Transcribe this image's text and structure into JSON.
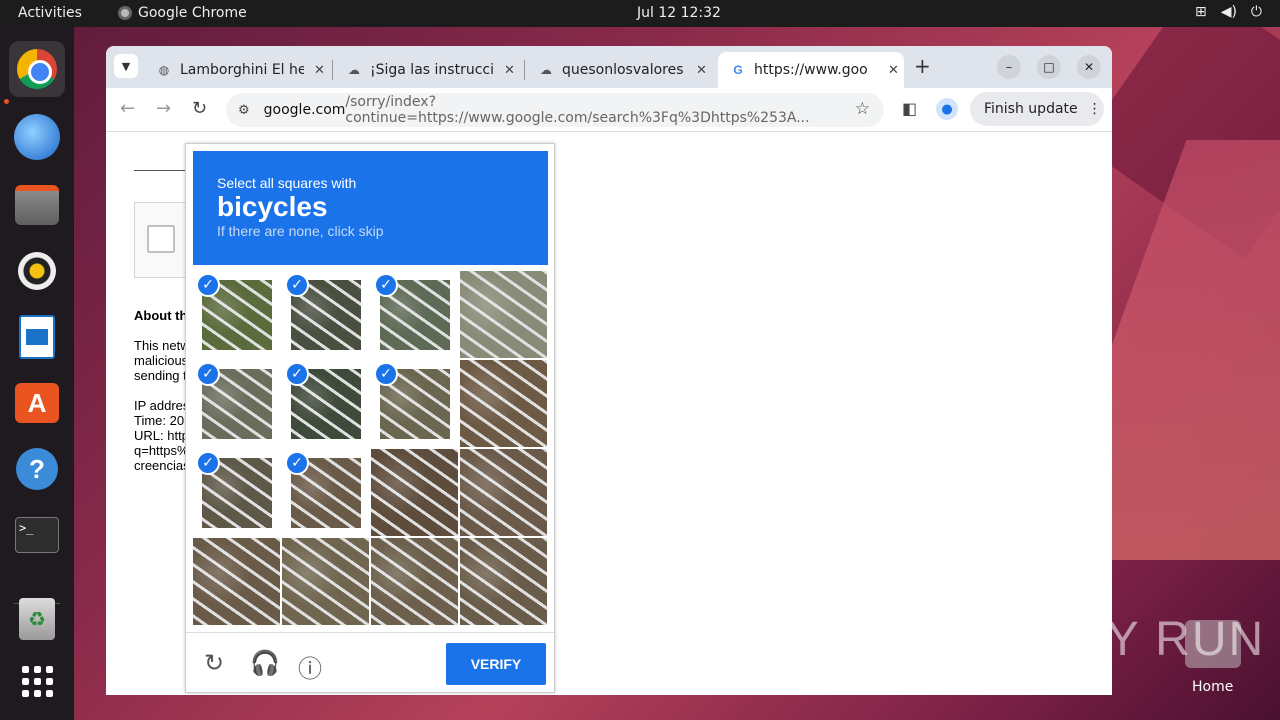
{
  "topbar": {
    "activities": "Activities",
    "app_name": "Google Chrome",
    "clock": "Jul 12  12:32"
  },
  "browser": {
    "tabs": [
      {
        "title": "Lamborghini El he",
        "icon": "globe-icon"
      },
      {
        "title": "¡Siga las instrucci",
        "icon": "download-icon"
      },
      {
        "title": "quesonlosvalores",
        "icon": "download-icon"
      },
      {
        "title": "https://www.goo",
        "icon": "google-icon",
        "active": true
      }
    ],
    "url_host": "google.com",
    "url_path": "/sorry/index?continue=https://www.google.com/search%3Fq%3Dhttps%253A...",
    "finish_update": "Finish update"
  },
  "page": {
    "about": "About th",
    "lines": [
      "This netw",
      "malicious",
      "sending t",
      "",
      "IP addres",
      "Time: 20",
      "URL: http",
      "q=https%",
      "creencias"
    ]
  },
  "captcha": {
    "instruction": "Select all squares with",
    "target": "bicycles",
    "hint": "If there are none, click skip",
    "verify_label": "VERIFY",
    "selected": [
      true,
      true,
      true,
      false,
      true,
      true,
      true,
      false,
      true,
      true,
      false,
      false,
      false,
      false,
      false,
      false
    ],
    "tile_colors": [
      "#5a6b3c",
      "#4a5040",
      "#5d6a55",
      "#8a8a78",
      "#6a6d5c",
      "#3e4a3a",
      "#6b6650",
      "#6d5a45",
      "#5e5848",
      "#6a5a48",
      "#5e4c3c",
      "#6b5a4a",
      "#6a5a48",
      "#706650",
      "#6c604c",
      "#6a5c4a"
    ]
  },
  "desktop": {
    "watermark": "ANY RUN",
    "home_label": "Home"
  }
}
